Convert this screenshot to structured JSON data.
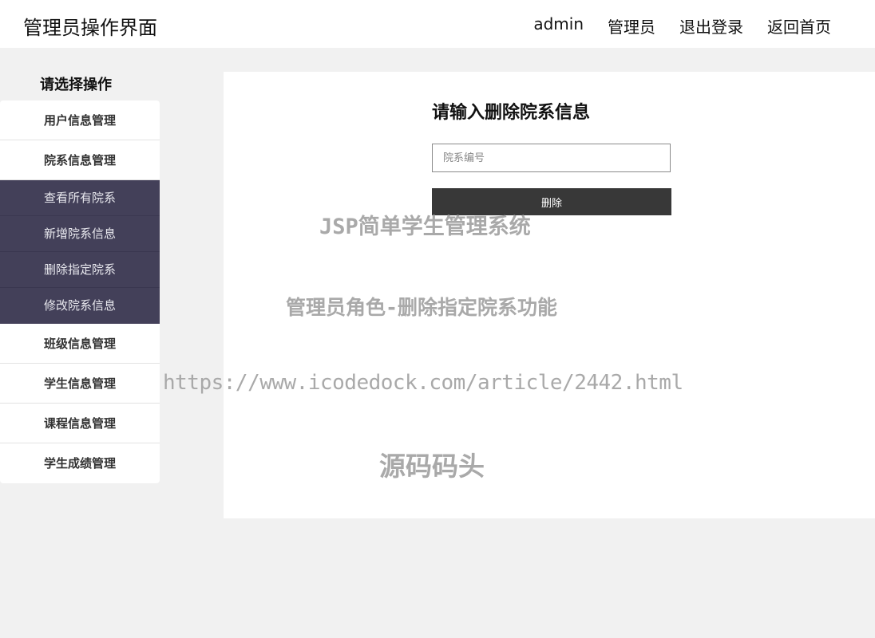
{
  "header": {
    "title": "管理员操作界面",
    "nav": {
      "user": "admin",
      "role": "管理员",
      "logout": "退出登录",
      "home": "返回首页"
    }
  },
  "sidebar": {
    "title": "请选择操作",
    "items": [
      {
        "label": "用户信息管理"
      },
      {
        "label": "院系信息管理"
      }
    ],
    "submenu": [
      {
        "label": "查看所有院系"
      },
      {
        "label": "新增院系信息"
      },
      {
        "label": "删除指定院系"
      },
      {
        "label": "修改院系信息"
      }
    ],
    "items_after": [
      {
        "label": "班级信息管理"
      },
      {
        "label": "学生信息管理"
      },
      {
        "label": "课程信息管理"
      },
      {
        "label": "学生成绩管理"
      }
    ]
  },
  "form": {
    "title": "请输入删除院系信息",
    "dept_id_placeholder": "院系编号",
    "dept_id_value": "",
    "submit_label": "删除"
  },
  "watermark": {
    "line1": "JSP简单学生管理系统",
    "line2": "管理员角色-删除指定院系功能",
    "line3": "https://www.icodedock.com/article/2442.html",
    "line4": "源码码头"
  },
  "colors": {
    "submenu_bg": "#434059",
    "button_bg": "#383838",
    "page_bg": "#f1f1f1"
  }
}
